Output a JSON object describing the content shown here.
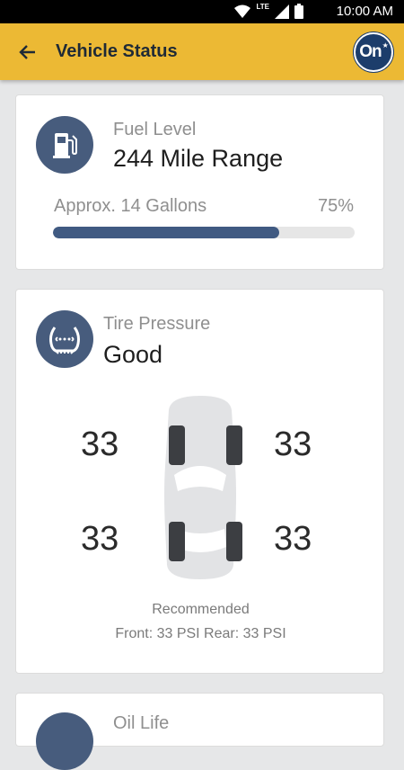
{
  "status_bar": {
    "time": "10:00 AM",
    "network": "LTE"
  },
  "app_bar": {
    "title": "Vehicle Status",
    "logo_text": "On"
  },
  "fuel": {
    "label": "Fuel Level",
    "range": "244 Mile Range",
    "gallons": "Approx. 14 Gallons",
    "percent_text": "75%",
    "percent": 75
  },
  "tire": {
    "label": "Tire Pressure",
    "status": "Good",
    "front_left": "33",
    "front_right": "33",
    "rear_left": "33",
    "rear_right": "33",
    "recommended_label": "Recommended",
    "recommended_detail": "Front: 33 PSI Rear: 33 PSI"
  },
  "oil": {
    "label": "Oil Life"
  },
  "colors": {
    "app_bar": "#ecb934",
    "icon_circle": "#475c7d",
    "progress_fill": "#405a82"
  }
}
